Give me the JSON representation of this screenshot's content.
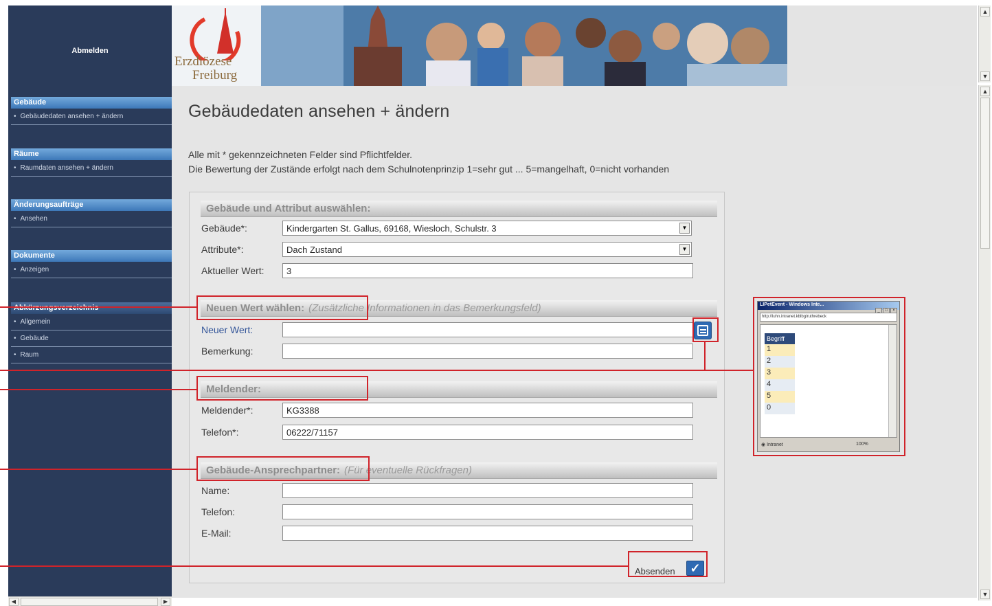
{
  "sidebar": {
    "logout": "Abmelden",
    "sections": [
      {
        "title": "Gebäude",
        "items": [
          "Gebäudedaten ansehen + ändern"
        ]
      },
      {
        "title": "Räume",
        "items": [
          "Raumdaten ansehen + ändern"
        ]
      },
      {
        "title": "Änderungsaufträge",
        "items": [
          "Ansehen"
        ]
      },
      {
        "title": "Dokumente",
        "items": [
          "Anzeigen"
        ]
      },
      {
        "title": "Abkürzungsverzeichnis",
        "items": [
          "Allgemein",
          "Gebäude",
          "Raum"
        ]
      }
    ]
  },
  "banner": {
    "logo_line1": "Erzdiözese",
    "logo_line2": "Freiburg"
  },
  "page": {
    "title": "Gebäudedaten ansehen + ändern",
    "info1": "Alle mit * gekennzeichneten Felder sind Pflichtfelder.",
    "info2": "Die Bewertung der Zustände erfolgt nach dem Schulnotenprinzip 1=sehr gut ... 5=mangelhaft, 0=nicht vorhanden"
  },
  "form": {
    "section1": {
      "title": "Gebäude und Attribut auswählen:"
    },
    "gebaeude_label": "Gebäude*:",
    "gebaeude_value": "Kindergarten St. Gallus, 69168, Wiesloch, Schulstr. 3",
    "attribute_label": "Attribute*:",
    "attribute_value": "Dach Zustand",
    "aktueller_label": "Aktueller Wert:",
    "aktueller_value": "3",
    "section2": {
      "title": "Neuen Wert wählen:",
      "sub": "(Zusätzliche Informationen in das Bemerkungsfeld)"
    },
    "neuer_label": "Neuer Wert:",
    "neuer_value": "",
    "bemerkung_label": "Bemerkung:",
    "bemerkung_value": "",
    "section3": {
      "title": "Meldender:"
    },
    "meldender_label": "Meldender*:",
    "meldender_value": "KG3388",
    "telefon_label": "Telefon*:",
    "telefon_value": "06222/71157",
    "section4": {
      "title": "Gebäude-Ansprechpartner:",
      "sub": "(Für eventuelle Rückfragen)"
    },
    "name_label": "Name:",
    "name_value": "",
    "telefon2_label": "Telefon:",
    "telefon2_value": "",
    "email_label": "E-Mail:",
    "email_value": "",
    "submit_label": "Absenden"
  },
  "popup": {
    "title": "LIPetEvent - Windows Inte...",
    "address": "http://luhn.intranet.kblbg/ruthrebeck",
    "header": "Begriff",
    "values": [
      "1",
      "2",
      "3",
      "4",
      "5",
      "0"
    ],
    "status_left": "Intranet",
    "status_right": "100%"
  },
  "colors": {
    "sidebar_bg": "#2a3b5a",
    "nav_head": "#3d78b8",
    "callout": "#d0232a",
    "content_bg": "#e5e5e5"
  }
}
